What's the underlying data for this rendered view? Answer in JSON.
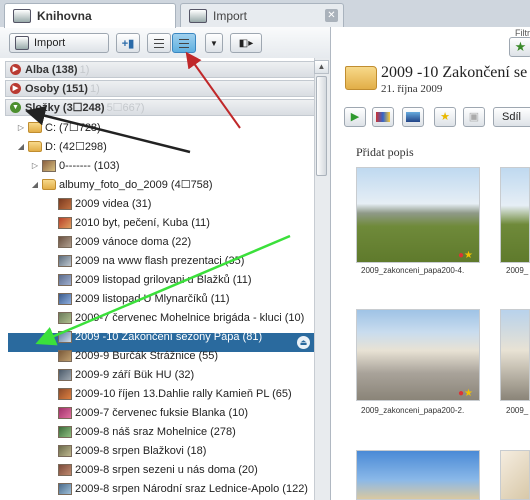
{
  "tabs": {
    "library": "Knihovna",
    "import": "Import",
    "close": "✕"
  },
  "toolbar": {
    "import_label": "Import"
  },
  "filter": {
    "label": "Filtr"
  },
  "sections": {
    "albums": {
      "label": "Alba (138)",
      "faded": "1)"
    },
    "people": {
      "label": "Osoby (151)",
      "faded": "1)"
    },
    "folders": {
      "label": "Složky (3☐248)",
      "faded": "5☐667)"
    }
  },
  "tree": {
    "drive_c": "C: (7☐728)",
    "drive_d": "D: (42☐298)",
    "folder_0": "0------- (103)",
    "albumy": "albumy_foto_do_2009 (4☐758)",
    "items": [
      "2009 videa (31)",
      "2010 byt, pečení, Kuba (11)",
      "2009 vánoce doma (22)",
      "2009 na www flash prezentaci (35)",
      "2009 listopad grilovani u Blažků (11)",
      "2009 listopad U Mlynarčíků (11)",
      "2009-7 červenec Mohelnice brigáda - kluci (10)",
      "2009 -10 Zakončení sezony Pápa (81)",
      "2009-9 Burčák Strážnice (55)",
      "2009-9 září Bük HU (32)",
      "2009-10 říjen 13.Dahlie rally Kamieň PL (65)",
      "2009-7 červenec fuksie Blanka (10)",
      "2009-8 náš sraz Mohelnice (278)",
      "2009-8 srpen  Blažkovi (18)",
      "2009-8 srpen sezeni u nás doma (20)",
      "2009-8 srpen Národní sraz Lednice-Apolo (122)"
    ]
  },
  "right": {
    "folder_title": "2009 -10 Zakončení se",
    "folder_date": "21. října 2009",
    "share_label": "Sdíl",
    "add_description": "Přidat popis",
    "captions": [
      "2009_zakonceni_papa200-4.",
      "2009_",
      "2009_zakonceni_papa200-2.",
      "2009_"
    ]
  },
  "colors": {
    "selection": "#2a6a9e",
    "accent_green": "#4d8f2e",
    "arrow_red": "#c0282a",
    "arrow_green": "#3be03b"
  }
}
